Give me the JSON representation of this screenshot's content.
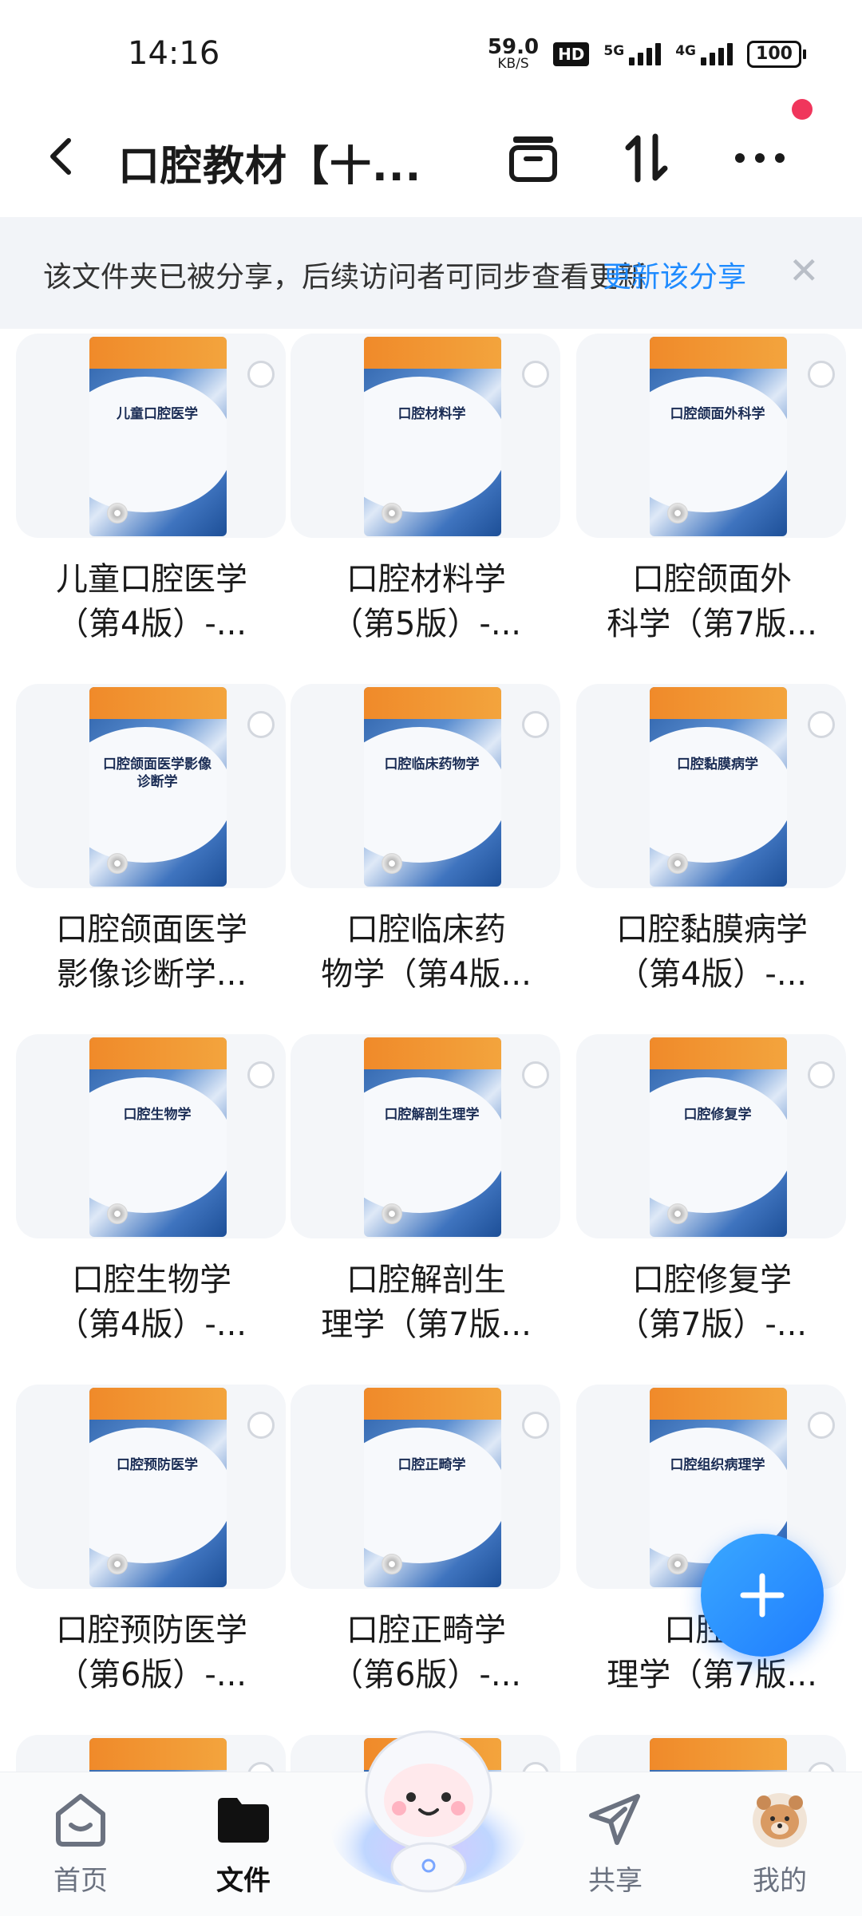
{
  "status_bar": {
    "time": "14:16",
    "net_speed_value": "59.0",
    "net_speed_unit": "KB/S",
    "hd_label": "HD",
    "signal_1_label": "5G",
    "signal_2_label": "4G",
    "battery": "100"
  },
  "header": {
    "title": "口腔教材【十...",
    "back_icon": "chevron-left-icon",
    "icons": [
      "archive-icon",
      "sort-icon",
      "more-icon"
    ]
  },
  "banner": {
    "text": "该文件夹已被分享，后续访问者可同步查看更新",
    "link": "更新该分享",
    "close": "✕"
  },
  "files": [
    {
      "cover_title": "儿童口腔医学",
      "name_line1": "儿童口腔医学",
      "name_line2": "（第4版）-..."
    },
    {
      "cover_title": "口腔材料学",
      "name_line1": "口腔材料学",
      "name_line2": "（第5版）-..."
    },
    {
      "cover_title": "口腔颌面外科学",
      "name_line1": "口腔颌面外",
      "name_line2": "科学（第7版..."
    },
    {
      "cover_title": "口腔颌面医学影像诊断学",
      "name_line1": "口腔颌面医学",
      "name_line2": "影像诊断学..."
    },
    {
      "cover_title": "口腔临床药物学",
      "name_line1": "口腔临床药",
      "name_line2": "物学（第4版..."
    },
    {
      "cover_title": "口腔黏膜病学",
      "name_line1": "口腔黏膜病学",
      "name_line2": "（第4版）-..."
    },
    {
      "cover_title": "口腔生物学",
      "name_line1": "口腔生物学",
      "name_line2": "（第4版）-..."
    },
    {
      "cover_title": "口腔解剖生理学",
      "name_line1": "口腔解剖生",
      "name_line2": "理学（第7版..."
    },
    {
      "cover_title": "口腔修复学",
      "name_line1": "口腔修复学",
      "name_line2": "（第7版）-..."
    },
    {
      "cover_title": "口腔预防医学",
      "name_line1": "口腔预防医学",
      "name_line2": "（第6版）-..."
    },
    {
      "cover_title": "口腔正畸学",
      "name_line1": "口腔正畸学",
      "name_line2": "（第6版）-..."
    },
    {
      "cover_title": "口腔组织病理学",
      "name_line1": "口腔组",
      "name_line2": "理学（第7版..."
    }
  ],
  "fab": {
    "icon": "plus-icon"
  },
  "nav": {
    "home": "首页",
    "files": "文件",
    "share": "共享",
    "mine": "我的"
  },
  "colors": {
    "accent": "#1f8bff",
    "badge": "#f0365c"
  }
}
